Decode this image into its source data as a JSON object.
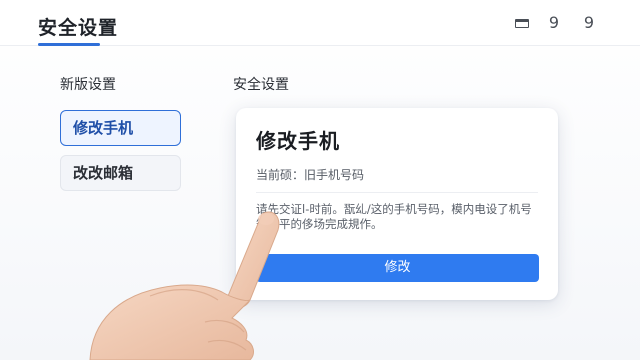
{
  "header": {
    "title": "安全设置",
    "icons": [
      "window-icon",
      "notification-icon",
      "profile-icon"
    ],
    "icon_glyphs": {
      "a": "9",
      "b": "9"
    }
  },
  "sidebar": {
    "section_label": "新版设置",
    "items": [
      {
        "label": "修改手机",
        "active": true
      },
      {
        "label": "改改邮箱",
        "active": false
      }
    ]
  },
  "main": {
    "section_label": "安全设置",
    "card": {
      "title": "修改手机",
      "current_label": "当前硕：旧手机号码",
      "description": "请先交证l-时前。翫乣/这的手机号码，模内电设了机号 箱和平的侈场完成規作。",
      "button_label": "修改"
    }
  },
  "colors": {
    "accent": "#2f7bf0",
    "active_border": "#2f6fd8",
    "active_bg": "#eef4ff"
  }
}
